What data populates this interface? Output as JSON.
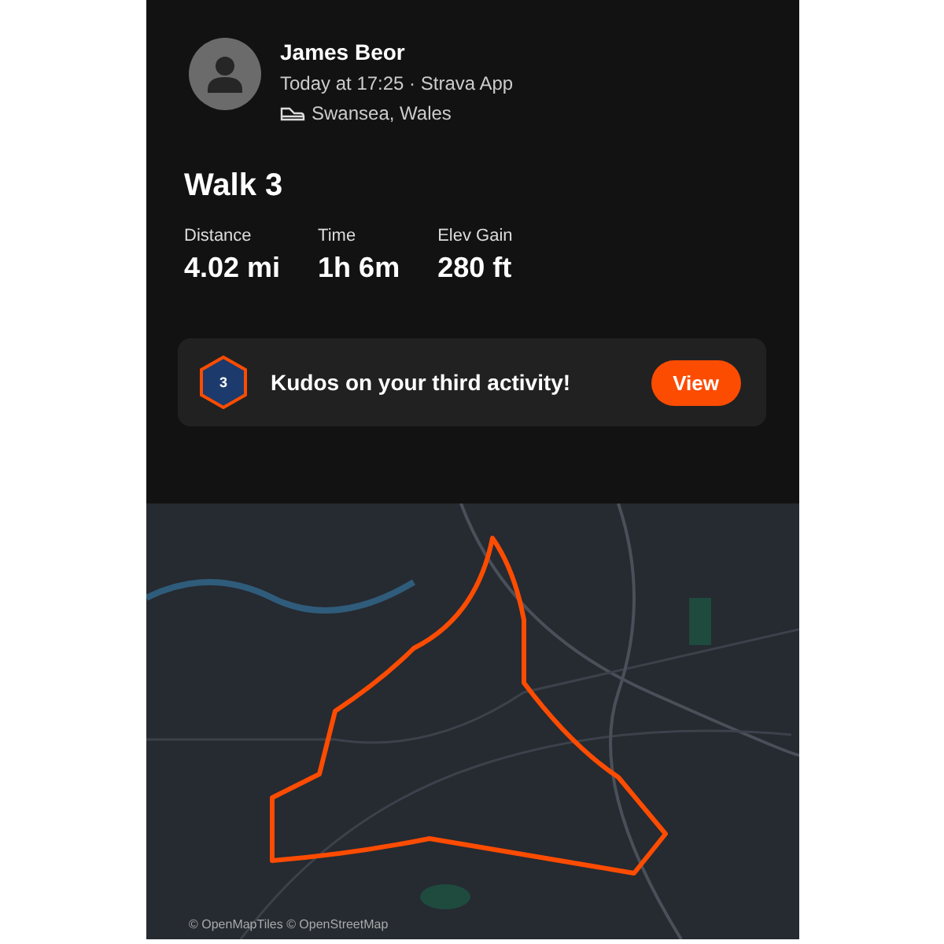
{
  "athlete": {
    "name": "James Beor",
    "meta": "Today at 17:25 · Strava App",
    "location": "Swansea, Wales"
  },
  "activity": {
    "title": "Walk 3",
    "stats": [
      {
        "label": "Distance",
        "value": "4.02 mi"
      },
      {
        "label": "Time",
        "value": "1h 6m"
      },
      {
        "label": "Elev Gain",
        "value": "280 ft"
      }
    ]
  },
  "kudos": {
    "badge": "3",
    "text": "Kudos on your third activity!",
    "button": "View"
  },
  "map": {
    "attribution": "© OpenMapTiles © OpenStreetMap"
  }
}
